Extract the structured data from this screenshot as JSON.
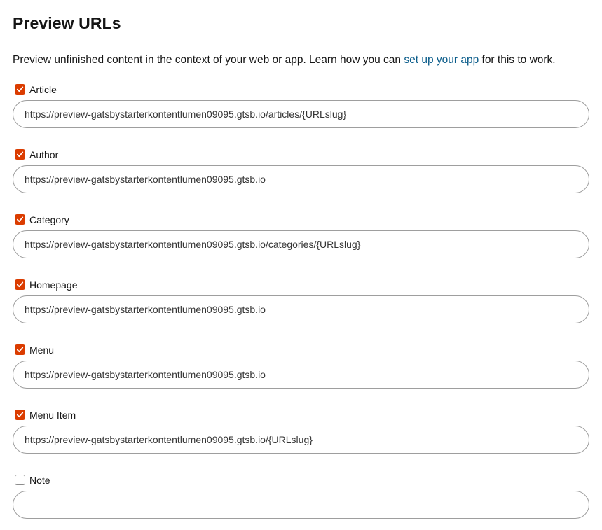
{
  "header": {
    "title": "Preview URLs"
  },
  "intro": {
    "text_before": "Preview unfinished content in the context of your web or app. Learn how you can ",
    "link_text": "set up your app",
    "text_after": " for this to work."
  },
  "content_types": [
    {
      "label": "Article",
      "checked": true,
      "url": "https://preview-gatsbystarterkontentlumen09095.gtsb.io/articles/{URLslug}"
    },
    {
      "label": "Author",
      "checked": true,
      "url": "https://preview-gatsbystarterkontentlumen09095.gtsb.io"
    },
    {
      "label": "Category",
      "checked": true,
      "url": "https://preview-gatsbystarterkontentlumen09095.gtsb.io/categories/{URLslug}"
    },
    {
      "label": "Homepage",
      "checked": true,
      "url": "https://preview-gatsbystarterkontentlumen09095.gtsb.io"
    },
    {
      "label": "Menu",
      "checked": true,
      "url": "https://preview-gatsbystarterkontentlumen09095.gtsb.io"
    },
    {
      "label": "Menu Item",
      "checked": true,
      "url": "https://preview-gatsbystarterkontentlumen09095.gtsb.io/{URLslug}"
    },
    {
      "label": "Note",
      "checked": false,
      "url": ""
    }
  ],
  "colors": {
    "accent": "#db3c00",
    "link": "#0a5c8a",
    "text": "#151515"
  },
  "icons": {
    "checkbox_mark": "check-icon"
  }
}
